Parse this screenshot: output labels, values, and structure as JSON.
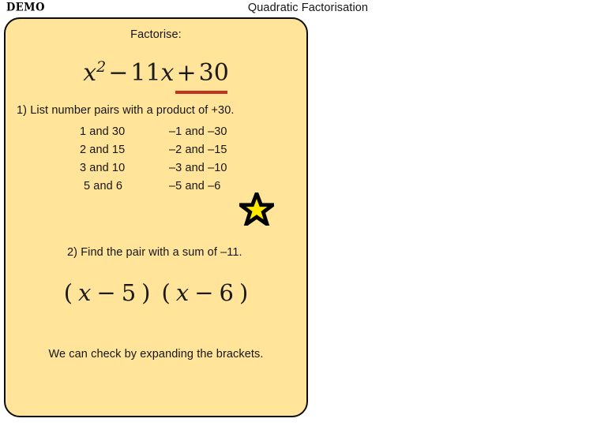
{
  "header": {
    "demo_badge": "DEMO",
    "title": "Quadratic Factorisation"
  },
  "card": {
    "prompt_label": "Factorise:",
    "quadratic": {
      "term1_var": "x",
      "term1_exp": "2",
      "op1": "−",
      "term2_coeff": "11",
      "term2_var": "x",
      "op2": "+",
      "term3": "30",
      "underline_color": "#C0341F",
      "full_text": "x² − 11x + 30"
    },
    "step1": "1) List number pairs with a product of +30.",
    "pairs": [
      {
        "positive": "1  and 30",
        "negative": "–1  and –30"
      },
      {
        "positive": "2  and 15",
        "negative": "–2  and –15"
      },
      {
        "positive": "3  and 10",
        "negative": "–3  and –10"
      },
      {
        "positive": "5  and 6",
        "negative": "–5  and –6"
      }
    ],
    "star_icon": "star-icon",
    "star_fill": "#FFE800",
    "star_stroke": "#000000",
    "step2": "2) Find the pair with a sum of –11.",
    "factored": {
      "open1": "(",
      "var1": "x",
      "op1": "−",
      "num1": "5",
      "close1": ")",
      "open2": "(",
      "var2": "x",
      "op2": "−",
      "num2": "6",
      "close2": ")",
      "full_text": "( x − 5 ) ( x − 6 )"
    },
    "closing_note": "We can check by expanding the brackets.",
    "background_color": "#FFE499",
    "border_color": "#0D0D0D"
  }
}
